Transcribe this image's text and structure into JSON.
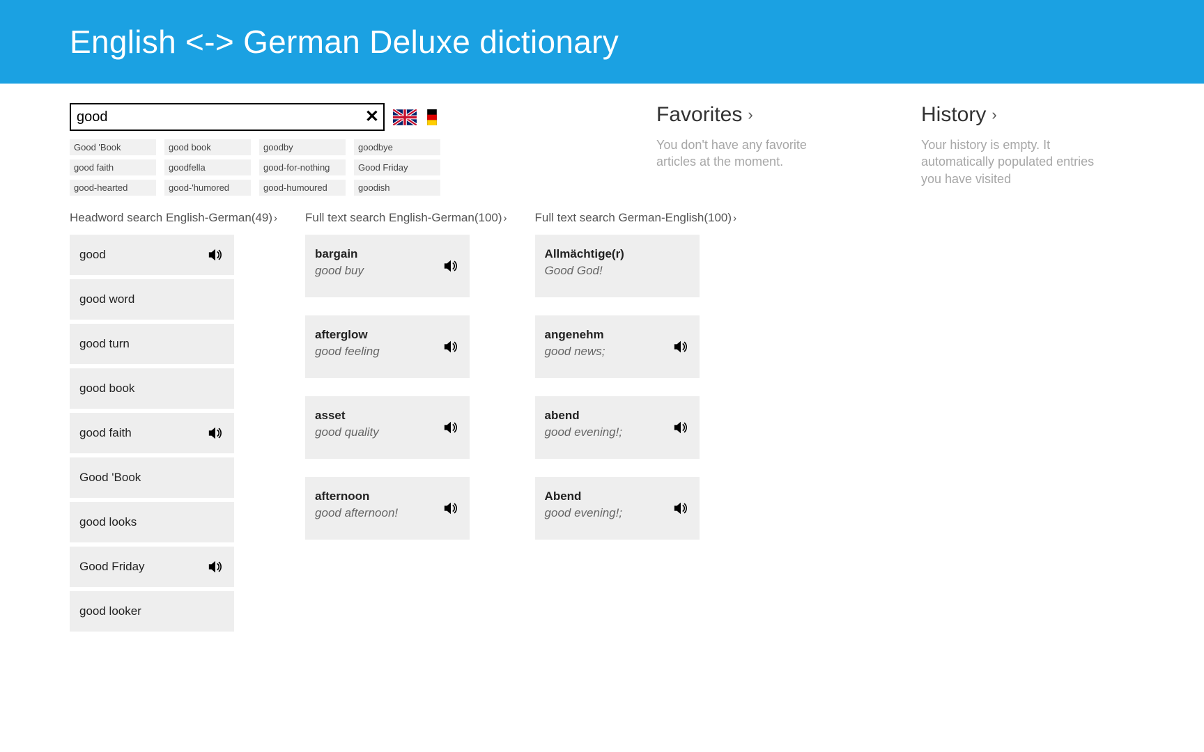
{
  "header": {
    "title": "English <-> German Deluxe dictionary"
  },
  "search": {
    "value": "good",
    "clearGlyph": "✕"
  },
  "suggestions": [
    "Good 'Book",
    "good book",
    "goodby",
    "goodbye",
    "good faith",
    "goodfella",
    "good-for-nothing",
    "Good Friday",
    "good-hearted",
    "good-'humored",
    "good-humoured",
    "goodish"
  ],
  "columns": {
    "headword": {
      "title": "Headword search English-German(49)",
      "items": [
        {
          "label": "good",
          "audio": true
        },
        {
          "label": "good word",
          "audio": false
        },
        {
          "label": "good turn",
          "audio": false
        },
        {
          "label": "good book",
          "audio": false
        },
        {
          "label": "good faith",
          "audio": true
        },
        {
          "label": "Good 'Book",
          "audio": false
        },
        {
          "label": "good looks",
          "audio": false
        },
        {
          "label": "Good Friday",
          "audio": true
        },
        {
          "label": "good looker",
          "audio": false
        }
      ]
    },
    "fulltextEnDe": {
      "title": "Full text search English-German(100)",
      "items": [
        {
          "term": "bargain",
          "trans": "good buy",
          "audio": true
        },
        {
          "term": "afterglow",
          "trans": "good feeling",
          "audio": true
        },
        {
          "term": "asset",
          "trans": "good quality",
          "audio": true
        },
        {
          "term": "afternoon",
          "trans": "good afternoon!",
          "audio": true
        }
      ]
    },
    "fulltextDeEn": {
      "title": "Full text search German-English(100)",
      "items": [
        {
          "term": "Allmächtige(r)",
          "trans": "Good God!",
          "audio": false
        },
        {
          "term": "angenehm",
          "trans": "good news;",
          "audio": true
        },
        {
          "term": "abend",
          "trans": "good evening!;",
          "audio": true
        },
        {
          "term": "Abend",
          "trans": "good evening!;",
          "audio": true
        }
      ]
    }
  },
  "favorites": {
    "title": "Favorites",
    "text": "You don't have any favorite articles at the moment."
  },
  "history": {
    "title": "History",
    "text": "Your history is empty. It automatically populated entries you have visited"
  }
}
